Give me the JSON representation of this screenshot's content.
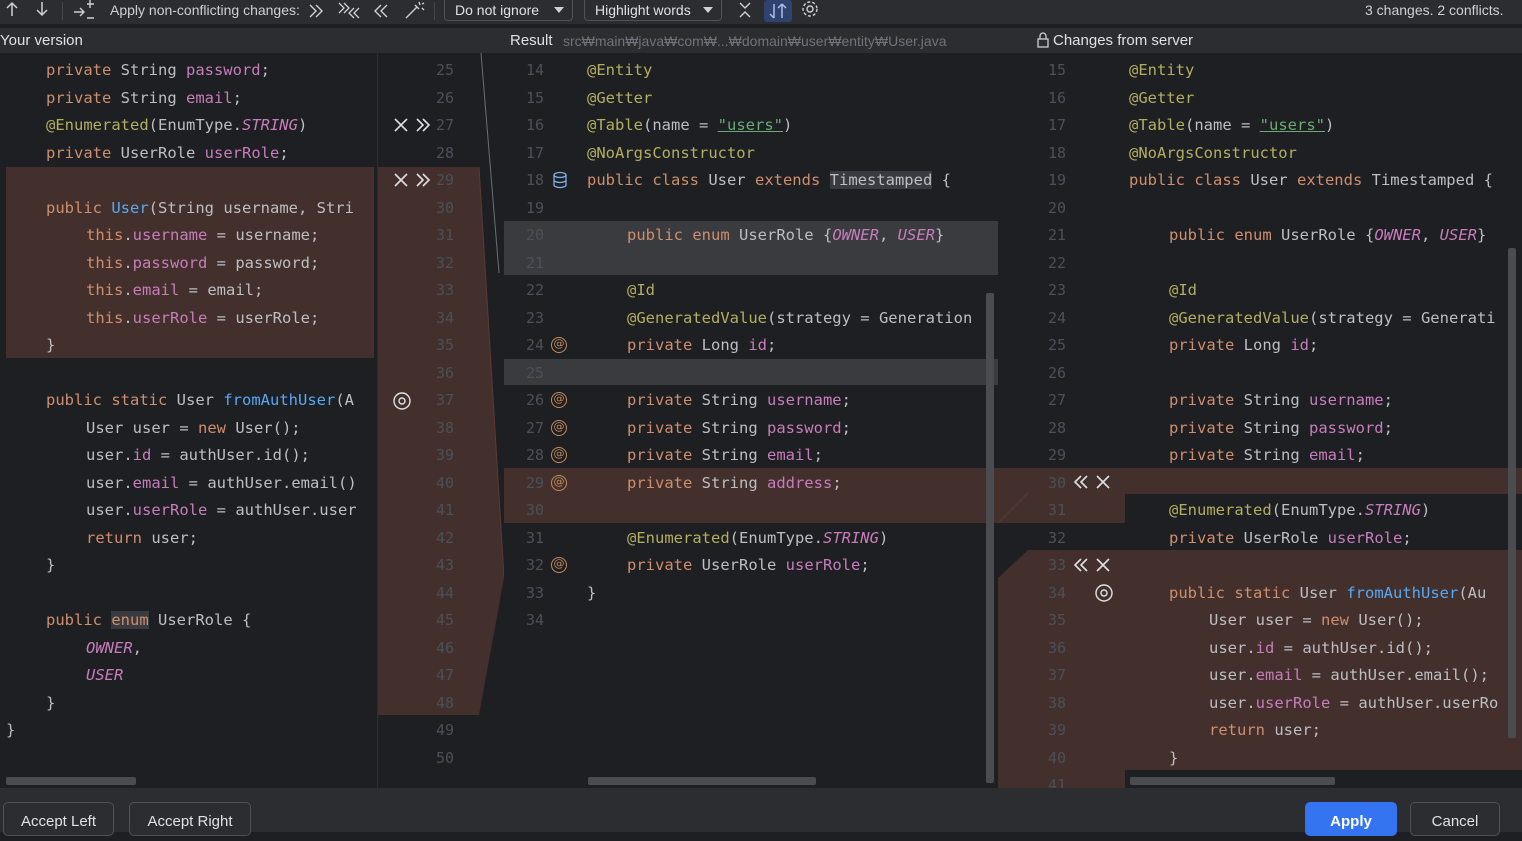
{
  "toolbar": {
    "apply_label": "Apply non-conflicting changes:",
    "ignore_option": "Do not ignore",
    "highlight_option": "Highlight words",
    "status": "3 changes. 2 conflicts."
  },
  "headers": {
    "left": "Your version",
    "center_label": "Result",
    "center_path": "src₩main₩java₩com₩...₩domain₩user₩entity₩User.java",
    "right": "Changes from server"
  },
  "gutter_left_numbers": [
    "25",
    "26",
    "27",
    "28",
    "29",
    "30",
    "31",
    "32",
    "33",
    "34",
    "35",
    "36",
    "37",
    "38",
    "39",
    "40",
    "41",
    "42",
    "43",
    "44",
    "45",
    "46",
    "47",
    "48",
    "49",
    "50"
  ],
  "gutter_center_numbers": [
    "14",
    "15",
    "16",
    "17",
    "18",
    "19",
    "20",
    "21",
    "22",
    "23",
    "24",
    "25",
    "26",
    "27",
    "28",
    "29",
    "30",
    "31",
    "32",
    "33",
    "34"
  ],
  "gutter_right_numbers": [
    "15",
    "16",
    "17",
    "18",
    "19",
    "20",
    "21",
    "22",
    "23",
    "24",
    "25",
    "26",
    "27",
    "28",
    "29",
    "30",
    "31",
    "32",
    "33",
    "34",
    "35",
    "36",
    "37",
    "38",
    "39",
    "40",
    "41"
  ],
  "left_lines": [
    "    private String password;",
    "    private String email;",
    "    @Enumerated(EnumType.STRING)",
    "    private UserRole userRole;",
    "",
    "    public User(String username, Stri",
    "        this.username = username;",
    "        this.password = password;",
    "        this.email = email;",
    "        this.userRole = userRole;",
    "    }",
    "",
    "    public static User fromAuthUser(A",
    "        User user = new User();",
    "        user.id = authUser.id();",
    "        user.email = authUser.email()",
    "        user.userRole = authUser.user",
    "        return user;",
    "    }",
    "",
    "    public enum UserRole {",
    "        OWNER,",
    "        USER",
    "    }",
    "}",
    ""
  ],
  "center_lines": [
    "@Entity",
    "@Getter",
    "@Table(name = \"users\")",
    "@NoArgsConstructor",
    "public class User extends Timestamped {",
    "",
    "    public enum UserRole {OWNER, USER}",
    "",
    "    @Id",
    "    @GeneratedValue(strategy = Generation",
    "    private Long id;",
    "",
    "    private String username;",
    "    private String password;",
    "    private String email;",
    "    private String address;",
    "",
    "    @Enumerated(EnumType.STRING)",
    "    private UserRole userRole;",
    "}",
    ""
  ],
  "right_lines": [
    "@Entity",
    "@Getter",
    "@Table(name = \"users\")",
    "@NoArgsConstructor",
    "public class User extends Timestamped {",
    "",
    "    public enum UserRole {OWNER, USER}",
    "",
    "    @Id",
    "    @GeneratedValue(strategy = Generati",
    "    private Long id;",
    "",
    "    private String username;",
    "    private String password;",
    "    private String email;",
    "",
    "    @Enumerated(EnumType.STRING)",
    "    private UserRole userRole;",
    "",
    "    public static User fromAuthUser(Au",
    "        User user = new User();",
    "        user.id = authUser.id();",
    "        user.email = authUser.email();",
    "        user.userRole = authUser.userRo",
    "        return user;",
    "    }",
    ""
  ],
  "buttons": {
    "accept_left": "Accept Left",
    "accept_right": "Accept Right",
    "apply": "Apply",
    "cancel": "Cancel"
  },
  "colors": {
    "background": "#1e1f22",
    "conflict": "#43302c",
    "modified": "#3a3b3f",
    "keyword": "#cf8e6d",
    "annotation": "#b3ae60",
    "function": "#56a8f5",
    "field": "#c77dbb",
    "string": "#6aab73",
    "accent": "#3574f0"
  }
}
